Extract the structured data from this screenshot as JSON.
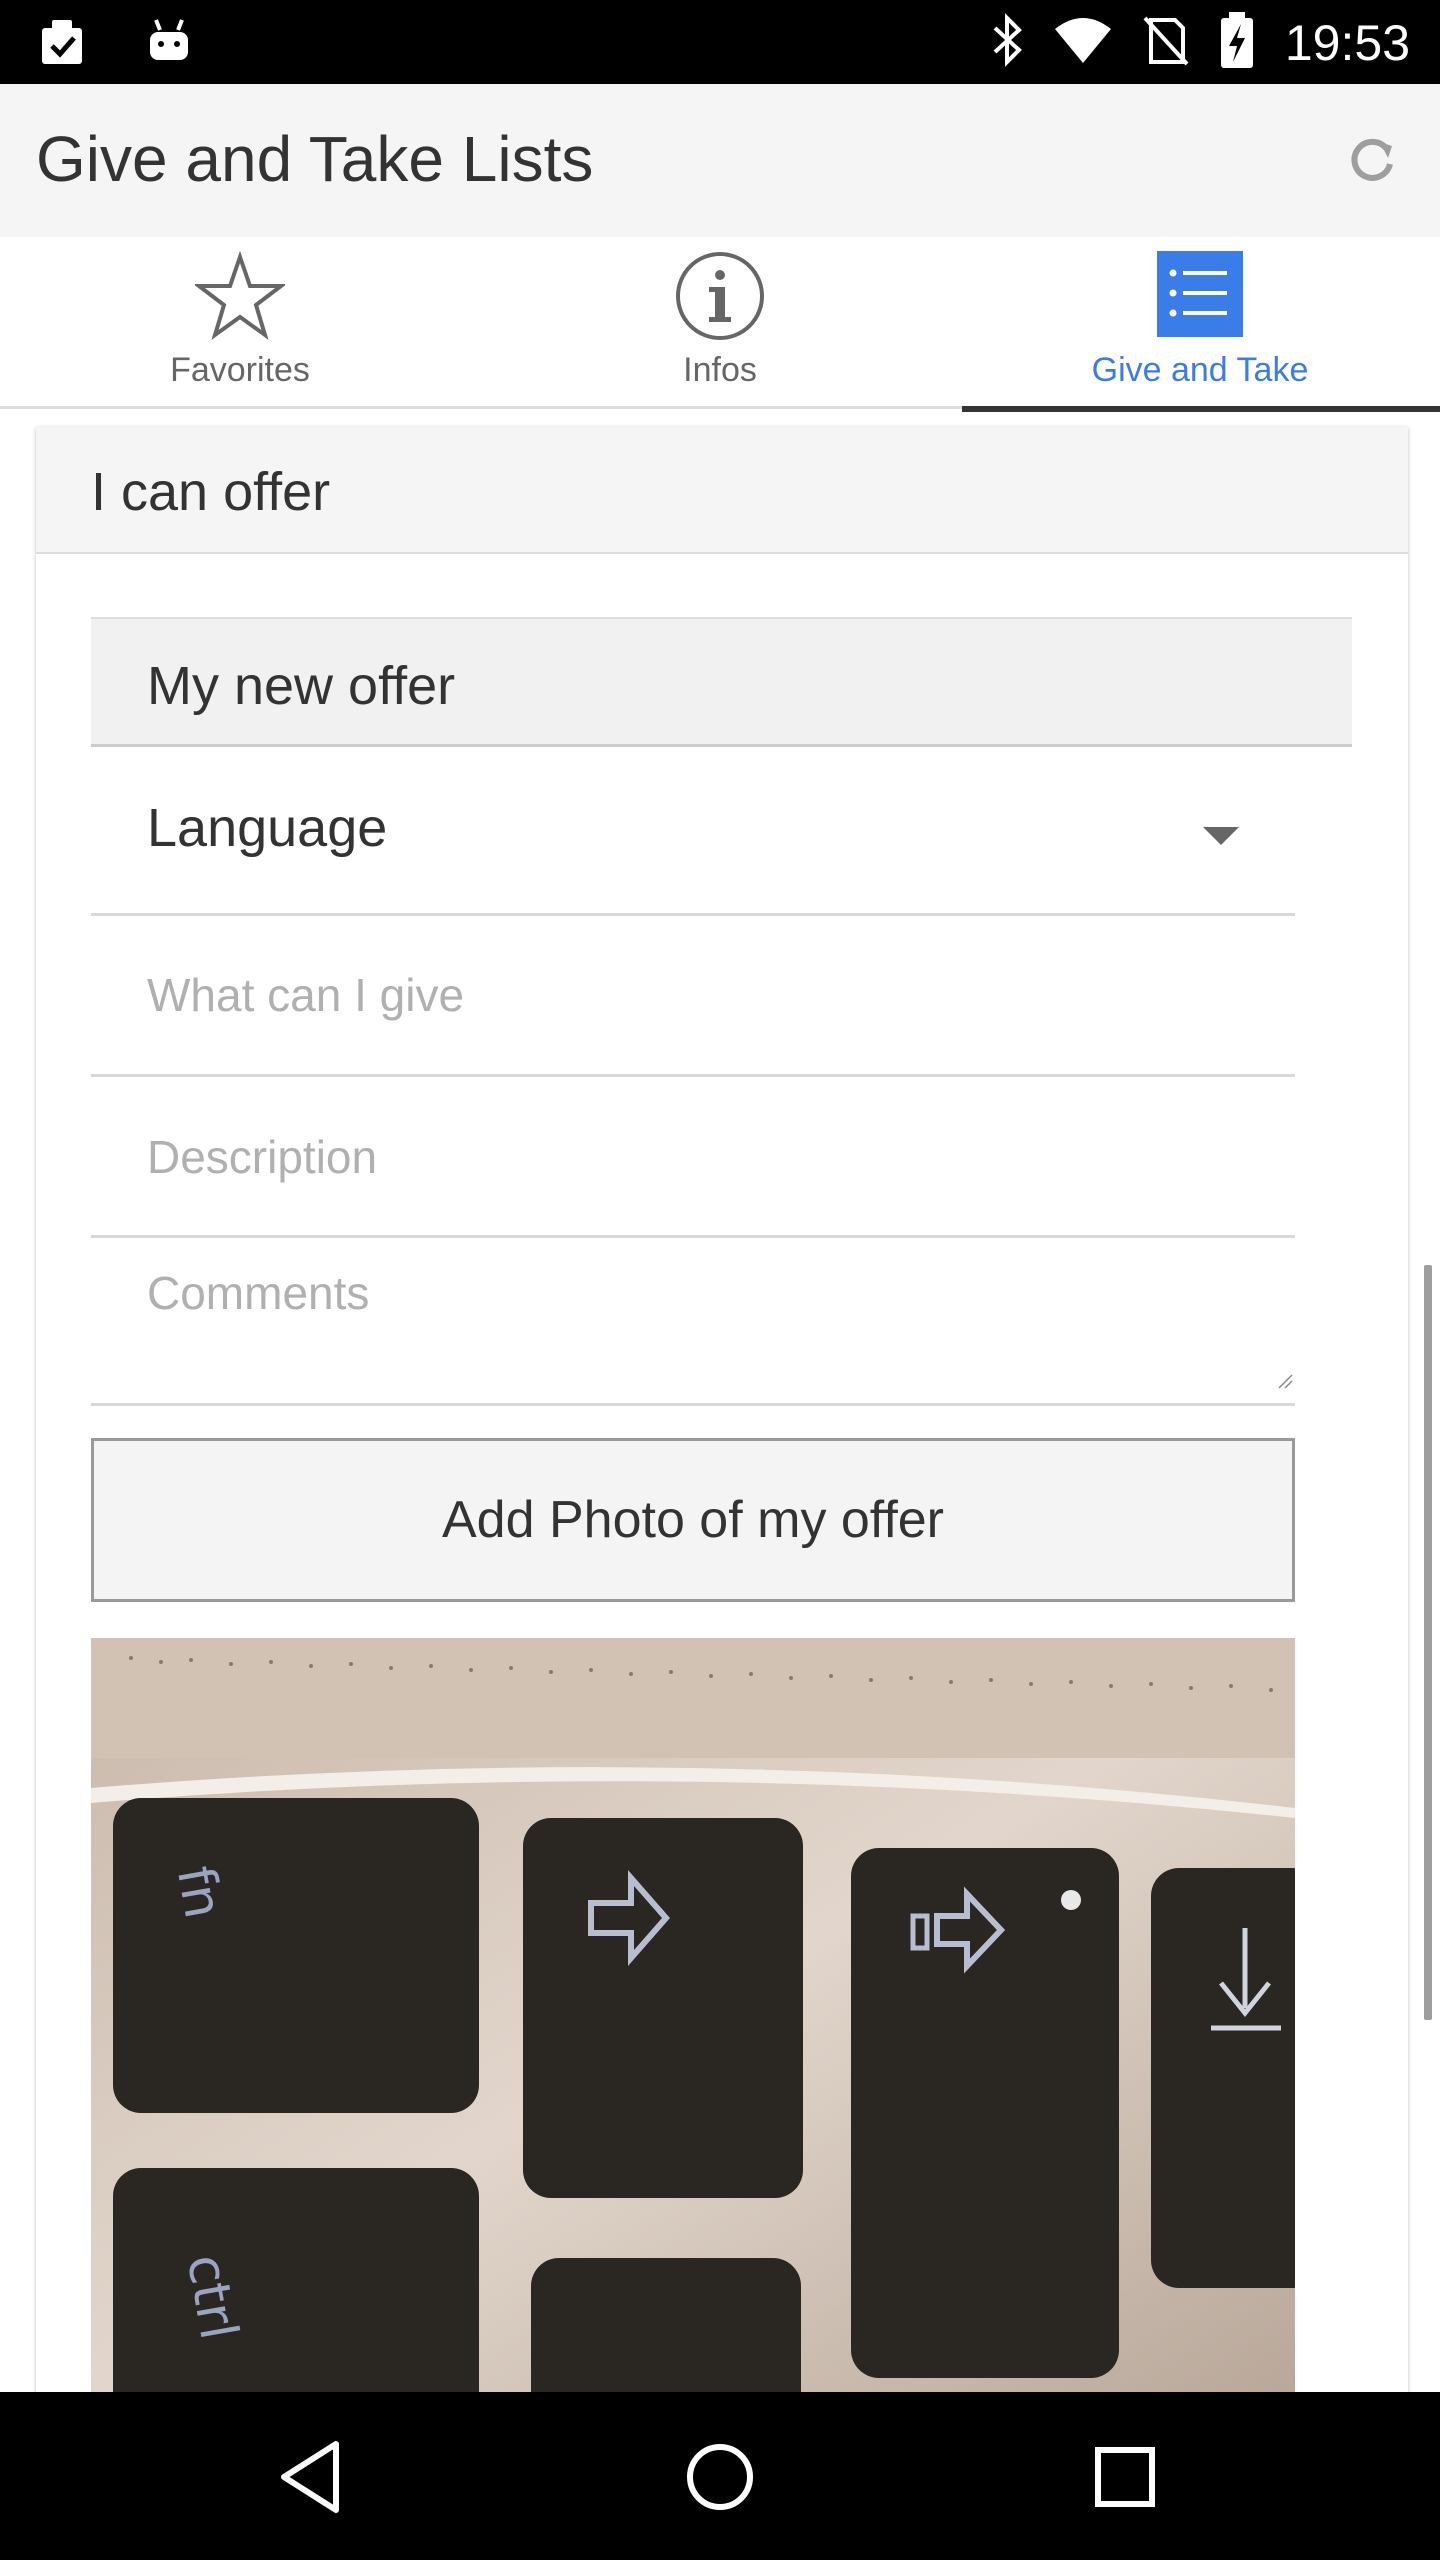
{
  "status_bar": {
    "time": "19:53",
    "left_icons": [
      "clipboard-check-icon",
      "android-icon"
    ],
    "right_icons": [
      "bluetooth-icon",
      "wifi-icon",
      "no-sim-icon",
      "battery-charging-icon"
    ]
  },
  "app_bar": {
    "title": "Give and Take Lists",
    "action_icon": "refresh-icon"
  },
  "tabs": [
    {
      "label": "Favorites",
      "icon": "star-icon",
      "active": false
    },
    {
      "label": "Infos",
      "icon": "info-icon",
      "active": false
    },
    {
      "label": "Give and Take",
      "icon": "list-icon",
      "active": true
    }
  ],
  "card": {
    "header": "I can offer",
    "offer_title": "My new offer",
    "language_select": {
      "value": "Language"
    },
    "what_field": {
      "placeholder": "What can I give"
    },
    "description_field": {
      "placeholder": "Description"
    },
    "comments_field": {
      "placeholder": "Comments"
    },
    "add_photo_button": "Add Photo of my offer",
    "photo": {
      "alt": "keyboard-photo",
      "key_labels": [
        "fn",
        "ctrl"
      ]
    }
  },
  "nav_bar": {
    "buttons": [
      "back-icon",
      "home-icon",
      "recents-icon"
    ]
  },
  "colors": {
    "accent": "#3b7de8",
    "status_bar": "#000000",
    "app_bar": "#f5f5f5"
  }
}
